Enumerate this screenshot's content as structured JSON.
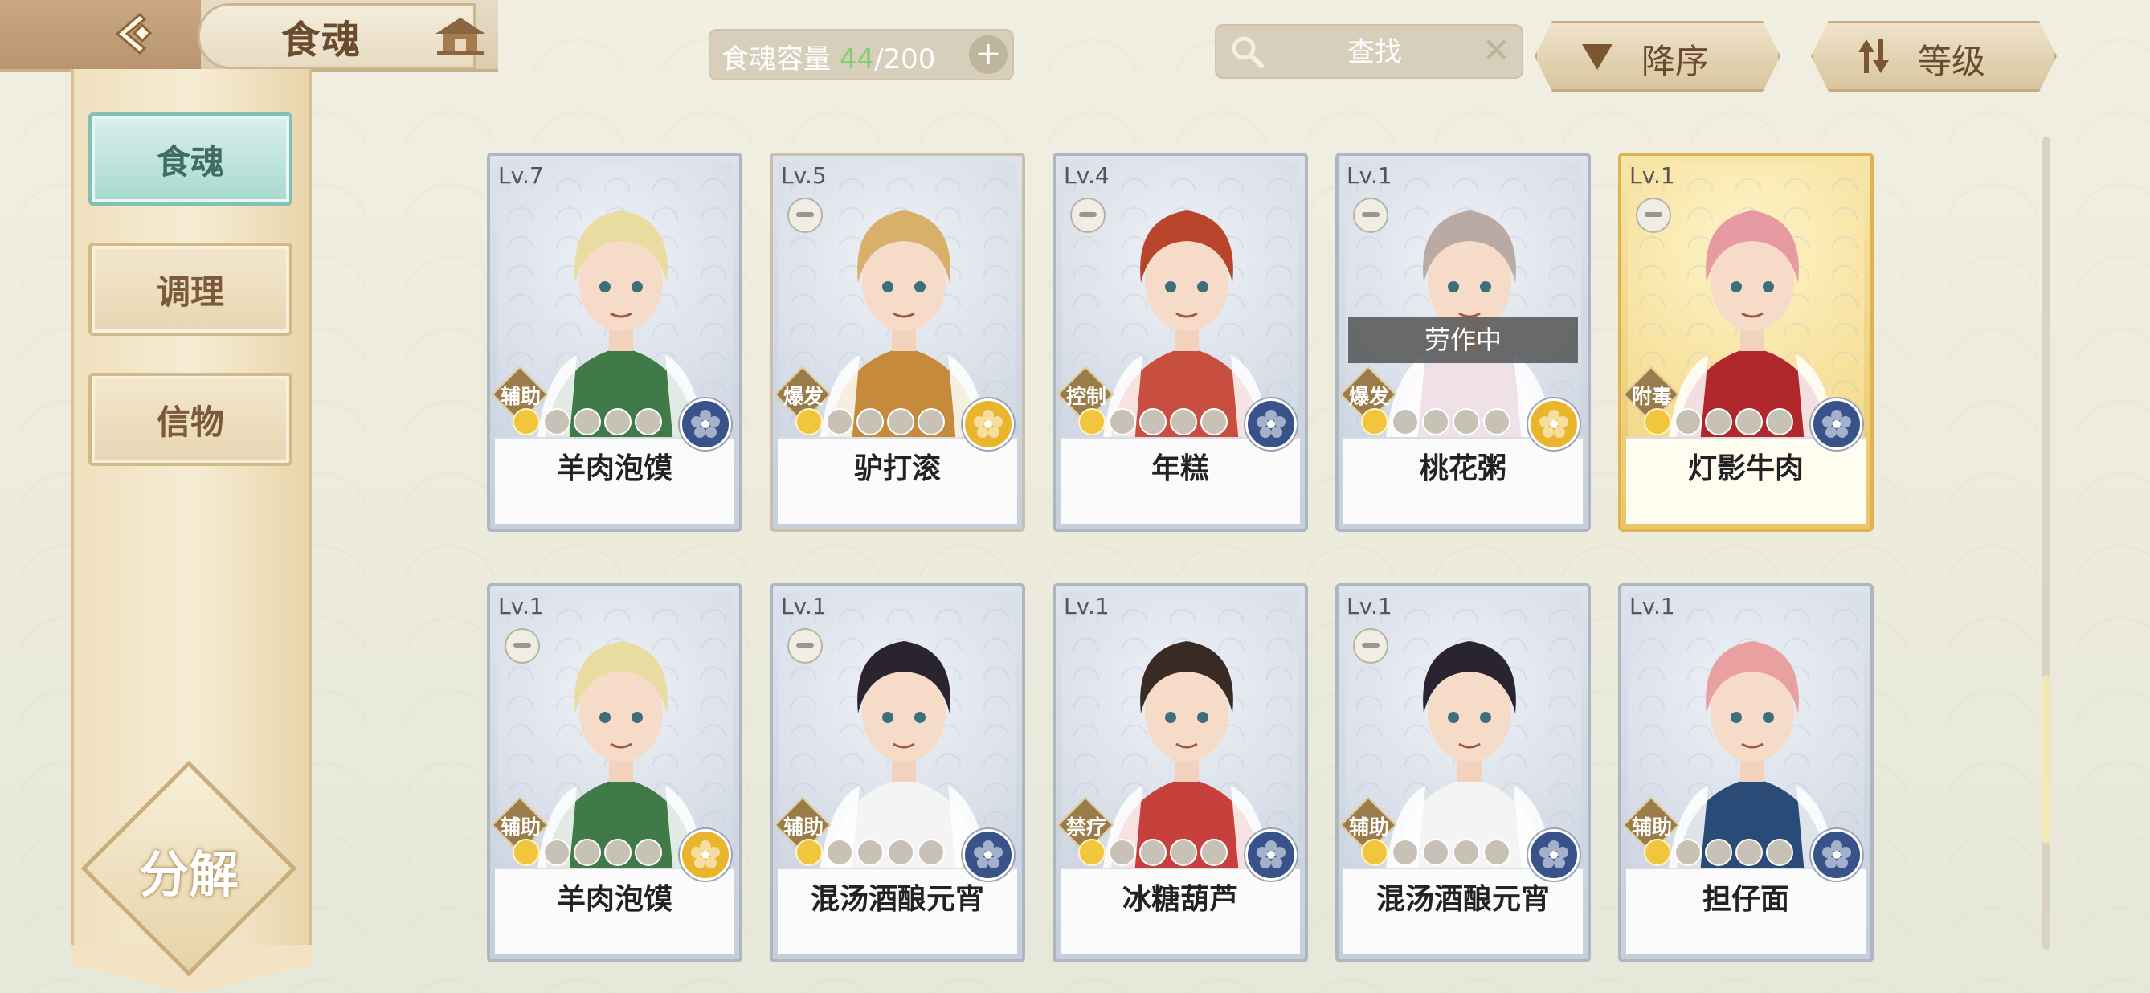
{
  "header": {
    "title": "食魂",
    "back_icon": "back-arrow-icon",
    "home_icon": "pavilion-icon"
  },
  "capacity": {
    "label": "食魂容量",
    "current": "44",
    "max": "/200",
    "add_symbol": "+"
  },
  "search": {
    "placeholder": "查找",
    "clear_symbol": "✕"
  },
  "sort": {
    "order_label": "降序",
    "by_label": "等级"
  },
  "sidebar": {
    "items": [
      {
        "label": "食魂",
        "active": true
      },
      {
        "label": "调理",
        "active": false
      },
      {
        "label": "信物",
        "active": false
      }
    ],
    "decompose_label": "分解"
  },
  "cards": [
    {
      "level": "Lv.7",
      "name": "羊肉泡馍",
      "role": "辅助",
      "element": "blue",
      "stars": 1,
      "frame": "silver",
      "pill": false,
      "status": ""
    },
    {
      "level": "Lv.5",
      "name": "驴打滚",
      "role": "爆发",
      "element": "gold",
      "stars": 1,
      "frame": "tan",
      "pill": true,
      "status": ""
    },
    {
      "level": "Lv.4",
      "name": "年糕",
      "role": "控制",
      "element": "blue",
      "stars": 1,
      "frame": "silver",
      "pill": true,
      "status": ""
    },
    {
      "level": "Lv.1",
      "name": "桃花粥",
      "role": "爆发",
      "element": "gold",
      "stars": 1,
      "frame": "silver",
      "pill": true,
      "status": "劳作中"
    },
    {
      "level": "Lv.1",
      "name": "灯影牛肉",
      "role": "附毒",
      "element": "blue",
      "stars": 1,
      "frame": "gold",
      "pill": true,
      "status": ""
    },
    {
      "level": "Lv.1",
      "name": "羊肉泡馍",
      "role": "辅助",
      "element": "gold",
      "stars": 1,
      "frame": "silver",
      "pill": true,
      "status": ""
    },
    {
      "level": "Lv.1",
      "name": "混汤酒酿元宵",
      "role": "辅助",
      "element": "blue",
      "stars": 1,
      "frame": "silver",
      "pill": true,
      "status": ""
    },
    {
      "level": "Lv.1",
      "name": "冰糖葫芦",
      "role": "禁疗",
      "element": "blue",
      "stars": 1,
      "frame": "silver",
      "pill": false,
      "status": ""
    },
    {
      "level": "Lv.1",
      "name": "混汤酒酿元宵",
      "role": "辅助",
      "element": "blue",
      "stars": 1,
      "frame": "silver",
      "pill": true,
      "status": ""
    },
    {
      "level": "Lv.1",
      "name": "担仔面",
      "role": "辅助",
      "element": "blue",
      "stars": 1,
      "frame": "silver",
      "pill": false,
      "status": ""
    }
  ],
  "colors": {
    "accent_gold": "#c6ab80",
    "capacity_current": "#7fd16a",
    "active_tab": "#a8d9cf"
  }
}
